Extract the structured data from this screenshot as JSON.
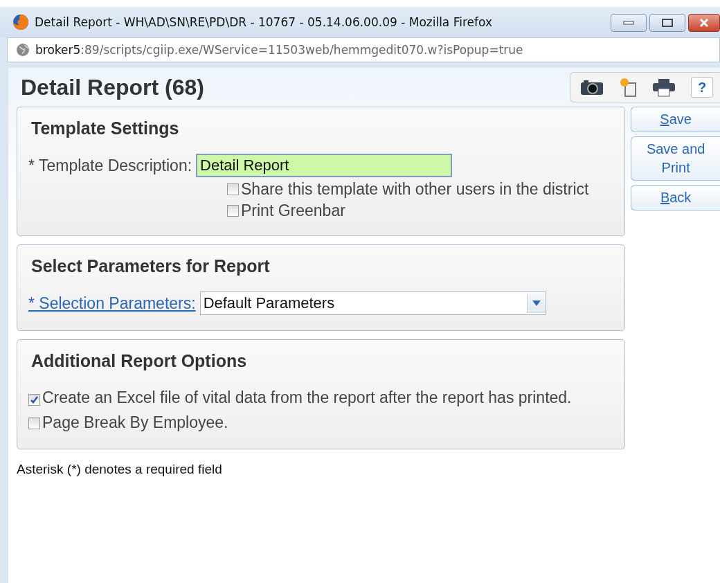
{
  "window": {
    "title": "Detail Report - WH\\AD\\SN\\RE\\PD\\DR - 10767 - 05.14.06.00.09 - Mozilla Firefox"
  },
  "address_bar": {
    "host": "broker5",
    "path": ":89/scripts/cgiip.exe/WService=11503web/hemmgedit070.w?isPopup=true"
  },
  "page_title": "Detail Report (68)",
  "toolbar": {
    "help": "?"
  },
  "side_buttons": [
    {
      "label": "Save",
      "accesskey_underlined": true
    },
    {
      "label": "Save and Print",
      "accesskey_underlined": false
    },
    {
      "label": "Back",
      "accesskey_underlined": true
    }
  ],
  "sections": [
    {
      "kind": "template",
      "title": "Template Settings",
      "field_label": "* Template Description:",
      "value": "Detail Report",
      "options": [
        {
          "label": "Share this template with other users in the district",
          "checked": false
        },
        {
          "label": "Print Greenbar",
          "checked": false
        }
      ]
    },
    {
      "kind": "parameters",
      "title": "Select Parameters for Report",
      "link": "* Selection Parameters:",
      "value": "Default Parameters"
    },
    {
      "kind": "options",
      "title": "Additional Report Options",
      "options": [
        {
          "label": "Create an Excel file of vital data from the report after the report has printed.",
          "checked": true
        },
        {
          "label": "Page Break By Employee.",
          "checked": false
        }
      ]
    }
  ],
  "footnote": "Asterisk (*) denotes a required field"
}
